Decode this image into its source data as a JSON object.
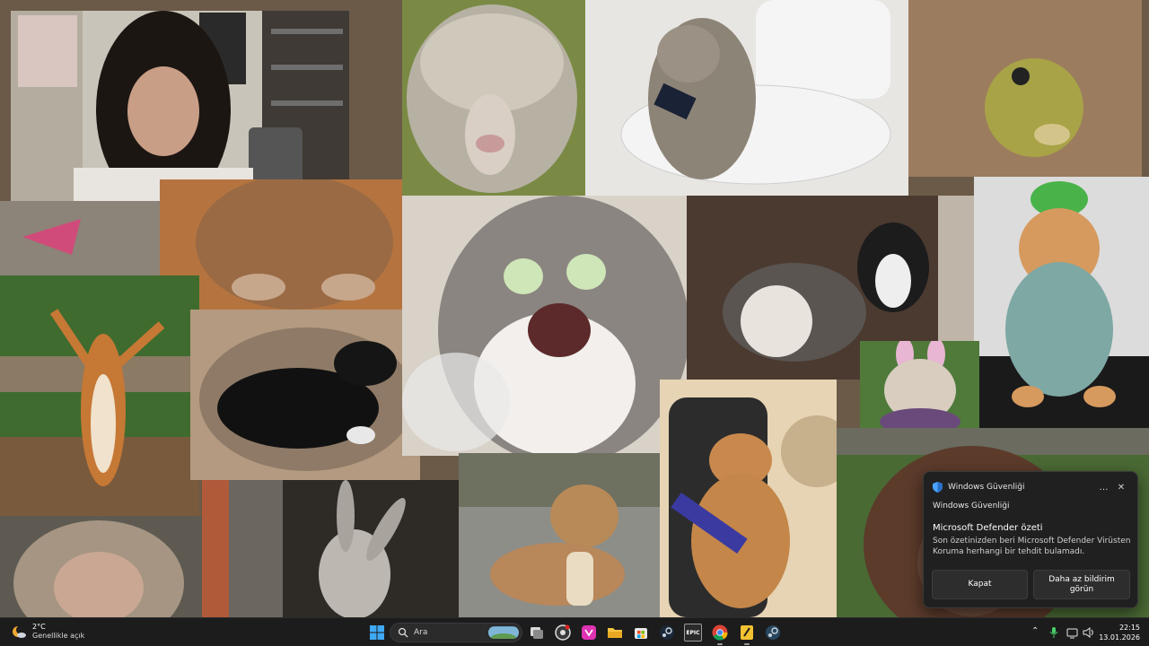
{
  "notification": {
    "app_name": "Windows Güvenliği",
    "source": "Windows Güvenliği",
    "title": "Microsoft Defender özeti",
    "body": "Son özetinizden beri Microsoft Defender Virüsten Koruma herhangi bir tehdit bulamadı.",
    "more_icon": "…",
    "close_icon": "✕",
    "button_dismiss": "Kapat",
    "button_less": "Daha az bildirim görün"
  },
  "taskbar": {
    "weather_temp": "2°C",
    "weather_condition": "Genellikle açık",
    "search_placeholder": "Ara",
    "time": "22:15",
    "date": "13.01.2026",
    "tray_chevron": "⌃",
    "epic_label": "EPIC",
    "pinned_apps": [
      "start",
      "search",
      "task-view",
      "chrome-alt",
      "pink-app",
      "file-explorer",
      "store",
      "steam",
      "epic-games",
      "chrome",
      "winamp-like",
      "steam-2"
    ]
  },
  "wallpaper": {
    "description_tiles": [
      "streamer-webcam",
      "sheep",
      "cat-on-toilet",
      "frog",
      "cat-blur",
      "screaming-cat",
      "dogs-fighting",
      "cat-green-hat",
      "squirrel",
      "black-dog-controller",
      "bulldog-bunny-ears",
      "gamer-cat",
      "monkey",
      "donkey",
      "dog-with-bread",
      "orangutan"
    ]
  },
  "colors": {
    "taskbar_bg": "#1c1c1c",
    "toast_bg": "#202020",
    "accent": "#4aa3ff"
  }
}
